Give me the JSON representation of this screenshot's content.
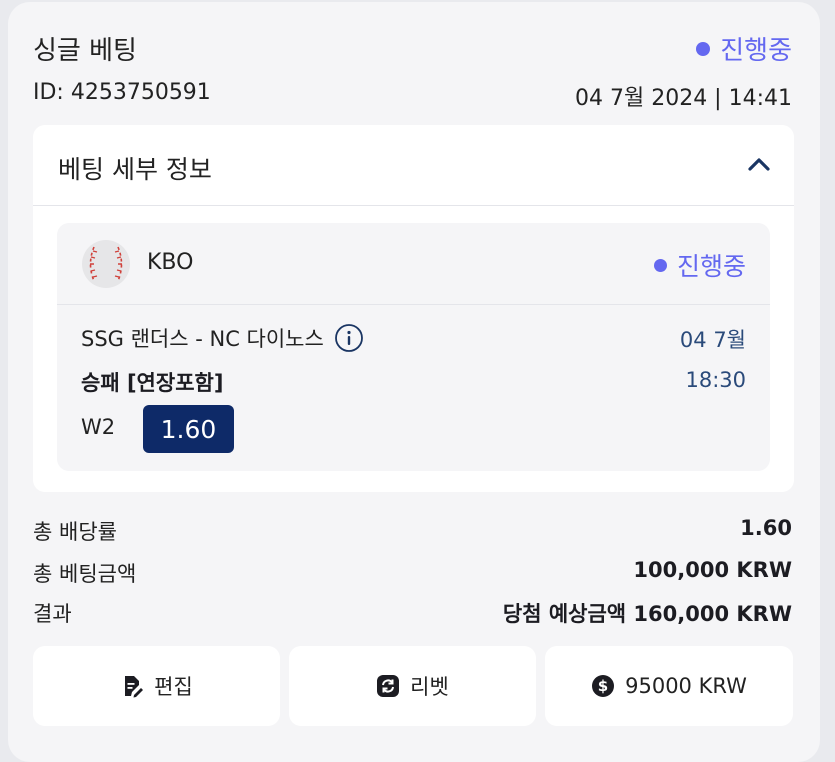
{
  "header": {
    "title": "싱글 베팅",
    "status": "진행중",
    "id_text": "ID: 4253750591",
    "datetime": "04 7월 2024 | 14:41"
  },
  "details": {
    "title": "베팅 세부 정보",
    "event": {
      "league": "KBO",
      "status": "진행중",
      "match": "SSG 랜더스 - NC 다이노스",
      "market": "승패 [연장포함]",
      "date": "04 7월",
      "time": "18:30",
      "pick": "W2",
      "odds": "1.60"
    }
  },
  "summary": {
    "total_odds_label": "총 배당률",
    "total_odds_value": "1.60",
    "stake_label": "총 베팅금액",
    "stake_value": "100,000 KRW",
    "result_label": "결과",
    "result_value": "당첨 예상금액 160,000 KRW"
  },
  "actions": {
    "edit_label": "편집",
    "rebet_label": "리벳",
    "cashout_label": "95000 KRW"
  },
  "colors": {
    "accent": "#6468f0",
    "odds_bg": "#0e2a68",
    "date_text": "#2a4a7a"
  },
  "icons": {
    "collapse": "chevron-up-icon",
    "sport": "baseball-icon",
    "info": "info-icon",
    "edit": "edit-document-icon",
    "rebet": "refresh-icon",
    "cashout": "dollar-coin-icon"
  }
}
